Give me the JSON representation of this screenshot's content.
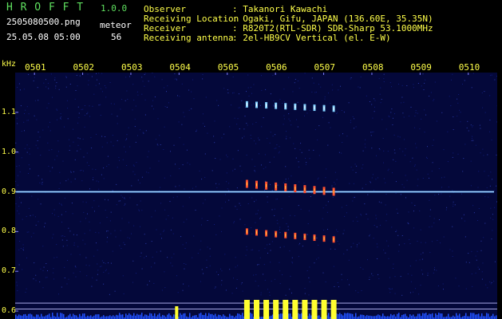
{
  "app": {
    "name": "H R O F F T",
    "version": "1.0.0",
    "filename": "2505080500.png",
    "mode": "meteor",
    "timestamp": "25.05.08 05:00",
    "count": "56"
  },
  "station": {
    "labels": [
      "Observer",
      "Receiving Location",
      "Receiver",
      "Receiving antenna"
    ],
    "values": [
      ": Takanori Kawachi",
      ": Ogaki, Gifu, JAPAN (136.60E, 35.35N)",
      ": R820T2(RTL-SDR) SDR-Sharp 53.1000MHz",
      ": 2el-HB9CV Vertical (el. E-W)"
    ]
  },
  "chart_data": {
    "type": "heatmap",
    "ylabel": "kHz",
    "x_tick_labels": [
      "0501",
      "0502",
      "0503",
      "0504",
      "0505",
      "0506",
      "0507",
      "0508",
      "0509",
      "0510"
    ],
    "y_tick_labels": [
      "1.1",
      "1.0",
      "0.9",
      "0.8",
      "0.7",
      "0.6"
    ],
    "y_ticks": [
      1.1,
      1.0,
      0.9,
      0.8,
      0.7,
      0.6
    ],
    "ylim": [
      0.58,
      1.2
    ],
    "carrier_khz": 0.9,
    "echo_rows_khz": [
      1.12,
      0.92,
      0.8
    ],
    "echo_minutes": [
      5.4,
      5.6,
      5.8,
      6.0,
      6.2,
      6.4,
      6.6,
      6.8,
      7.0,
      7.2
    ],
    "xlim_minutes": [
      0.6,
      10.6
    ],
    "colors": {
      "background": "#04083a",
      "carrier": "#5fb0ff",
      "echo": "#ff5030",
      "level_bars": "#ffff30",
      "text": "#ffff4a",
      "header_green": "#5fe05f"
    }
  }
}
